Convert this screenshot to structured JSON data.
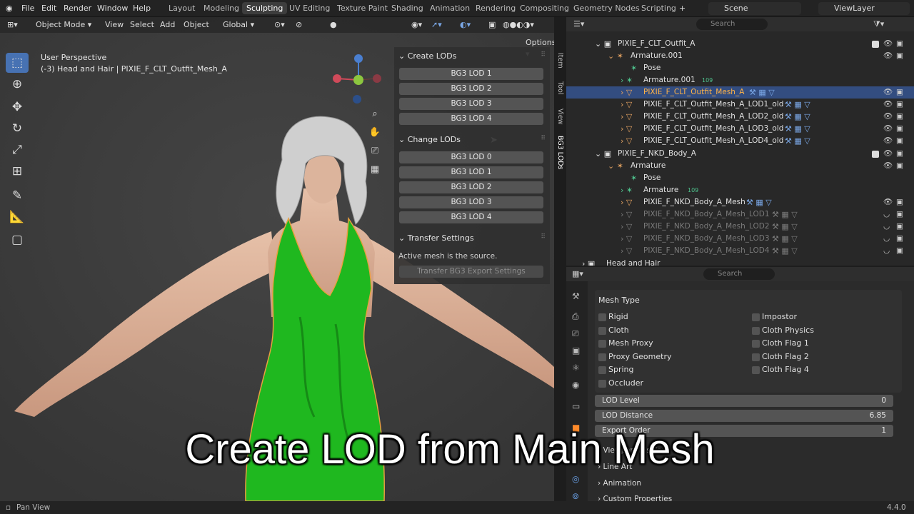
{
  "menus": [
    "File",
    "Edit",
    "Render",
    "Window",
    "Help"
  ],
  "workspaces": [
    "Layout",
    "Modeling",
    "Sculpting",
    "UV Editing",
    "Texture Paint",
    "Shading",
    "Animation",
    "Rendering",
    "Compositing",
    "Geometry Nodes",
    "Scripting"
  ],
  "active_workspace": "Sculpting",
  "scene": "Scene",
  "view_layer": "ViewLayer",
  "viewport": {
    "mode": "Object Mode",
    "header_menus": [
      "View",
      "Select",
      "Add",
      "Object"
    ],
    "transform": "Global",
    "options": "Options",
    "view_name": "User Perspective",
    "view_info": "(-3) Head and Hair | PIXIE_F_CLT_Outfit_Mesh_A",
    "tabs": [
      "Item",
      "Tool",
      "View",
      "BG3 LODs"
    ]
  },
  "npanel": {
    "create_title": "Create LODs",
    "create_buttons": [
      "BG3 LOD 1",
      "BG3 LOD 2",
      "BG3 LOD 3",
      "BG3 LOD 4"
    ],
    "change_title": "Change LODs",
    "change_buttons": [
      "BG3 LOD 0",
      "BG3 LOD 1",
      "BG3 LOD 2",
      "BG3 LOD 3",
      "BG3 LOD 4"
    ],
    "transfer_title": "Transfer Settings",
    "transfer_note": "Active mesh is the source.",
    "transfer_button": "Transfer BG3 Export Settings"
  },
  "outliner": {
    "search_placeholder": "Search",
    "rows": [
      {
        "label": "PIXIE_F_CLT_Outfit_A"
      },
      {
        "label": "Armature.001"
      },
      {
        "label": "Pose"
      },
      {
        "label": "Armature.001",
        "badge": "109"
      },
      {
        "label": "PIXIE_F_CLT_Outfit_Mesh_A"
      },
      {
        "label": "PIXIE_F_CLT_Outfit_Mesh_A_LOD1_old"
      },
      {
        "label": "PIXIE_F_CLT_Outfit_Mesh_A_LOD2_old"
      },
      {
        "label": "PIXIE_F_CLT_Outfit_Mesh_A_LOD3_old"
      },
      {
        "label": "PIXIE_F_CLT_Outfit_Mesh_A_LOD4_old"
      },
      {
        "label": "PIXIE_F_NKD_Body_A"
      },
      {
        "label": "Armature"
      },
      {
        "label": "Pose"
      },
      {
        "label": "Armature",
        "badge": "109"
      },
      {
        "label": "PIXIE_F_NKD_Body_A_Mesh"
      },
      {
        "label": "PIXIE_F_NKD_Body_A_Mesh_LOD1"
      },
      {
        "label": "PIXIE_F_NKD_Body_A_Mesh_LOD2"
      },
      {
        "label": "PIXIE_F_NKD_Body_A_Mesh_LOD3"
      },
      {
        "label": "PIXIE_F_NKD_Body_A_Mesh_LOD4"
      },
      {
        "label": "Head and Hair"
      }
    ]
  },
  "properties": {
    "search_placeholder": "Search",
    "mesh_type_title": "Mesh Type",
    "left_checks": [
      "Rigid",
      "Cloth",
      "Mesh Proxy",
      "Proxy Geometry",
      "Spring",
      "Occluder"
    ],
    "right_checks": [
      "Impostor",
      "Cloth Physics",
      "Cloth Flag 1",
      "Cloth Flag 2",
      "Cloth Flag 4"
    ],
    "lod_level_label": "LOD Level",
    "lod_level_value": "0",
    "lod_distance_label": "LOD Distance",
    "lod_distance_value": "6.85",
    "export_order_label": "Export Order",
    "export_order_value": "1",
    "sub_viewport": "Viewport Display",
    "sub_lineart": "Line Art",
    "sub_animation": "Animation",
    "sub_custom": "Custom Properties"
  },
  "status": {
    "left": "Pan View",
    "version": "4.4.0"
  },
  "caption": "Create LOD from Main Mesh",
  "colors": {
    "accent": "#4772b3",
    "selection": "#334d80",
    "dress": "#1fb81f",
    "skin": "#e2b9a1"
  }
}
